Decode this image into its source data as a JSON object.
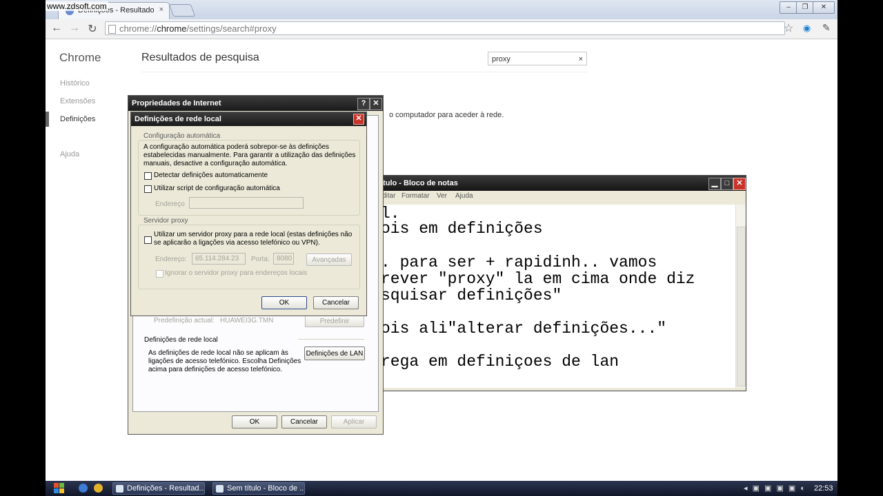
{
  "watermark": "www.zdsoft.com",
  "browser": {
    "tab_title": "Definições - Resultados de pesquisa",
    "tab_close": "×",
    "url_prefix": "chrome://",
    "url_host": "chrome",
    "url_path": "/settings/search#proxy",
    "win_min": "‒",
    "win_max": "❐",
    "win_close": "✕"
  },
  "settings": {
    "brand": "Chrome",
    "nav": [
      "Histórico",
      "Extensões",
      "Definições",
      "Ajuda"
    ],
    "page_title": "Resultados de pesquisa",
    "search_value": "proxy",
    "search_clear": "×",
    "proxy_text": "o computador para aceder à rede."
  },
  "internet_props": {
    "title": "Propriedades de Internet",
    "help": "?",
    "close": "✕",
    "preset_label": "Predefinição actual:",
    "preset_value": "HUAWEI3G.TMN",
    "preset_button": "Predefinir",
    "lan_section": "Definições de rede local",
    "lan_desc_1": "As definições de rede local não se aplicam às",
    "lan_desc_2": "ligações de acesso telefónico. Escolha Definições",
    "lan_desc_3": "acima para definições de acesso telefónico.",
    "lan_button": "Definições de LAN",
    "ok": "OK",
    "cancel": "Cancelar",
    "apply": "Aplicar"
  },
  "lan_dialog": {
    "title": "Definições de rede local",
    "close": "✕",
    "auto_group": "Configuração automática",
    "auto_desc_1": "A configuração automática poderá sobrepor-se às definições",
    "auto_desc_2": "estabelecidas manualmente. Para garantir a utilização das definições",
    "auto_desc_3": "manuais, desactive a configuração automática.",
    "detect": "Detectar definições automaticamente",
    "script": "Utilizar script de configuração automática",
    "address": "Endereço",
    "proxy_group": "Servidor proxy",
    "use_proxy_1": "Utilizar um servidor proxy para a rede local (estas definições não",
    "use_proxy_2": "se aplicarão a ligações via acesso telefónico ou VPN).",
    "proxy_address_label": "Endereço:",
    "proxy_address": "65.114.284.23",
    "port_label": "Porta:",
    "port": "8080",
    "advanced": "Avançadas",
    "bypass": "Ignorar o servidor proxy para endereços locais",
    "ok": "OK",
    "cancel": "Cancelar"
  },
  "notepad": {
    "title": "ítulo - Bloco de notas",
    "menu": [
      "ditar",
      "Formatar",
      "Ver",
      "Ajuda"
    ],
    "min": "▁",
    "max": "□",
    "close": "✕",
    "lines": [
      "l.",
      "ois em definições",
      "",
      ". para ser + rapidinh.. vamos",
      "rever \"proxy\" la em cima onde diz",
      "squisar definições\"",
      "",
      "ois ali\"alterar definições...\"",
      "",
      "rega em definiçoes de lan"
    ]
  },
  "taskbar": {
    "item1": "Definições - Resultad...",
    "item2": "Sem título - Bloco de ...",
    "clock": "22:53"
  },
  "colors": {
    "xp_face": "#ece9d8",
    "title_dark": "#1a1a1a",
    "chrome_frame": "#c9d4e6",
    "close_red": "#c8342a"
  }
}
